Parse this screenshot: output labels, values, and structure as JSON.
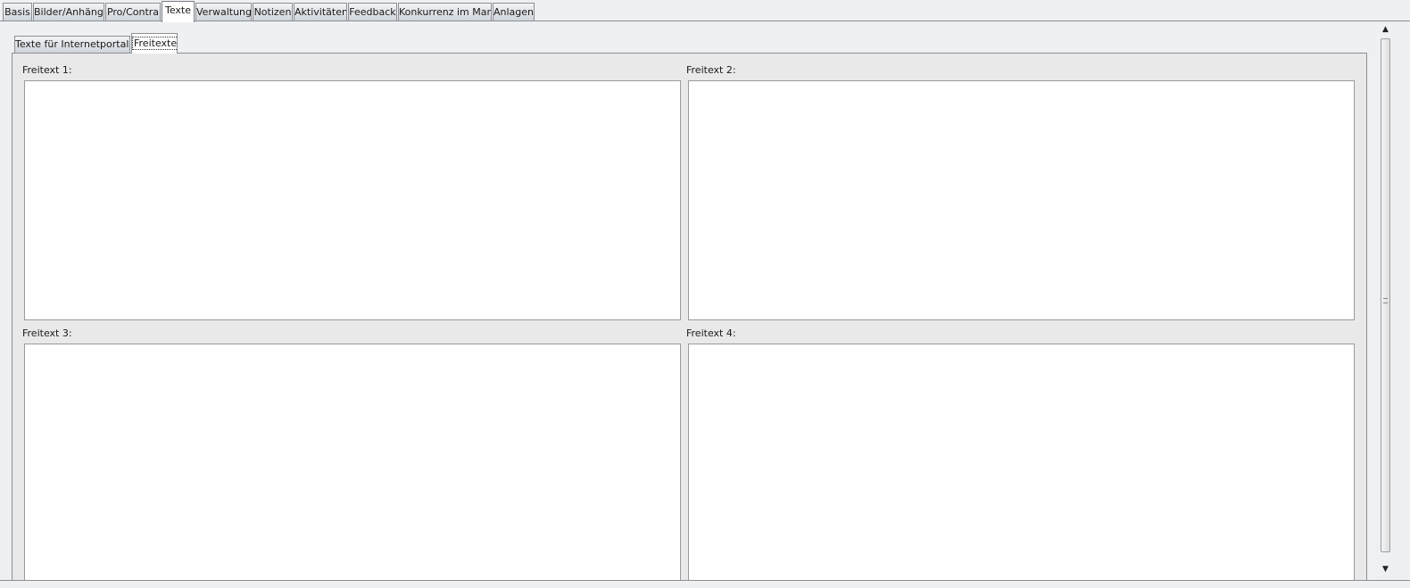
{
  "top_tabs": [
    {
      "label": "Basis",
      "active": false
    },
    {
      "label": "Bilder/Anhänge",
      "active": false
    },
    {
      "label": "Pro/Contra",
      "active": false
    },
    {
      "label": "Texte",
      "active": true
    },
    {
      "label": "Verwaltung",
      "active": false
    },
    {
      "label": "Notizen",
      "active": false
    },
    {
      "label": "Aktivitäten",
      "active": false
    },
    {
      "label": "Feedback",
      "active": false
    },
    {
      "label": "Konkurrenz im Markt",
      "active": false
    },
    {
      "label": "Anlagen",
      "active": false
    }
  ],
  "sub_tabs": [
    {
      "label": "Texte für Internetportale",
      "active": false
    },
    {
      "label": "Freitexte",
      "active": true
    }
  ],
  "fields": [
    {
      "label": "Freitext 1:",
      "value": ""
    },
    {
      "label": "Freitext 2:",
      "value": ""
    },
    {
      "label": "Freitext 3:",
      "value": ""
    },
    {
      "label": "Freitext 4:",
      "value": ""
    }
  ],
  "scrollbar": {
    "up_icon": "triangle-up",
    "down_icon": "triangle-down"
  }
}
